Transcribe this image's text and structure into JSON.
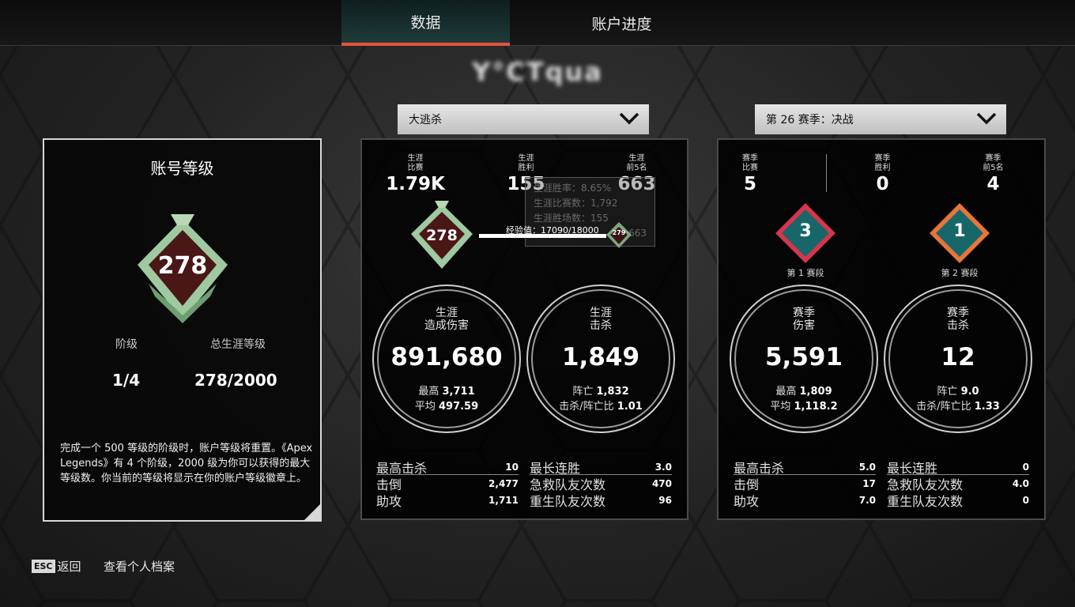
{
  "tabs": [
    {
      "label": "数据",
      "active": true
    },
    {
      "label": "账户进度",
      "active": false
    }
  ],
  "username": "Y°CTqua",
  "account_panel": {
    "title": "账号等级",
    "badge_level": "278",
    "tier_label": "阶级",
    "tier_value": "1/4",
    "career_label": "总生涯等级",
    "career_value": "278/2000",
    "description": "完成一个 500 等级的阶级时，账户等级将重置。《Apex Legends》有 4 个阶级，2000 级为你可以获得的最大等级数。你当前的等级将显示在你的账户等级徽章上。"
  },
  "mode_dropdown": {
    "label": "大逃杀"
  },
  "season_dropdown": {
    "label": "第 26 赛季：决战"
  },
  "career_panel": {
    "top_stats": [
      {
        "label1": "生涯",
        "label2": "比赛",
        "value": "1.79K"
      },
      {
        "label1": "生涯",
        "label2": "胜利",
        "value": "155"
      },
      {
        "label1": "生涯",
        "label2": "前5名",
        "value": "663"
      }
    ],
    "current_badge": "278",
    "next_badge": "279",
    "xp_label": "经验值：17090/18000",
    "xp_progress": 0.949,
    "tooltip": [
      "生涯胜率：8.65%",
      "生涯比赛数：1,792",
      "生涯胜场数：155",
      "663"
    ],
    "damage": {
      "title1": "生涯",
      "title2": "造成伤害",
      "value": "891,680",
      "sub1_label": "最高",
      "sub1_value": "3,711",
      "sub2_label": "平均",
      "sub2_value": "497.59"
    },
    "kills": {
      "title1": "生涯",
      "title2": "击杀",
      "value": "1,849",
      "sub1_label": "阵亡",
      "sub1_value": "1,832",
      "sub2_label": "击杀/阵亡比",
      "sub2_value": "1.01"
    },
    "table_left": [
      {
        "name": "最高击杀",
        "value": "10"
      },
      {
        "name": "击倒",
        "value": "2,477"
      },
      {
        "name": "助攻",
        "value": "1,711"
      }
    ],
    "table_right": [
      {
        "name": "最长连胜",
        "value": "3.0"
      },
      {
        "name": "急救队友次数",
        "value": "470"
      },
      {
        "name": "重生队友次数",
        "value": "96"
      }
    ]
  },
  "season_panel": {
    "top_stats": [
      {
        "label1": "赛季",
        "label2": "比赛",
        "value": "5"
      },
      {
        "label1": "赛季",
        "label2": "胜利",
        "value": "0"
      },
      {
        "label1": "赛季",
        "label2": "前5名",
        "value": "4"
      }
    ],
    "split1": {
      "value": "3",
      "label": "第 1 赛段",
      "color": "#d8344b"
    },
    "split2": {
      "value": "1",
      "label": "第 2 赛段",
      "color": "#e8743a"
    },
    "damage": {
      "title1": "赛季",
      "title2": "伤害",
      "value": "5,591",
      "sub1_label": "最高",
      "sub1_value": "1,809",
      "sub2_label": "平均",
      "sub2_value": "1,118.2"
    },
    "kills": {
      "title1": "赛季",
      "title2": "击杀",
      "value": "12",
      "sub1_label": "阵亡",
      "sub1_value": "9.0",
      "sub2_label": "击杀/阵亡比",
      "sub2_value": "1.33"
    },
    "table_left": [
      {
        "name": "最高击杀",
        "value": "5.0"
      },
      {
        "name": "击倒",
        "value": "17"
      },
      {
        "name": "助攻",
        "value": "7.0"
      }
    ],
    "table_right": [
      {
        "name": "最长连胜",
        "value": "0"
      },
      {
        "name": "急救队友次数",
        "value": "4.0"
      },
      {
        "name": "重生队友次数",
        "value": "0"
      }
    ]
  },
  "footer": {
    "esc_key": "ESC",
    "back_label": "返回",
    "profile_label": "查看个人档案"
  },
  "colors": {
    "accent": "#e8533a",
    "badge_green": "#9fc9a0",
    "badge_dark": "#4a1717"
  }
}
